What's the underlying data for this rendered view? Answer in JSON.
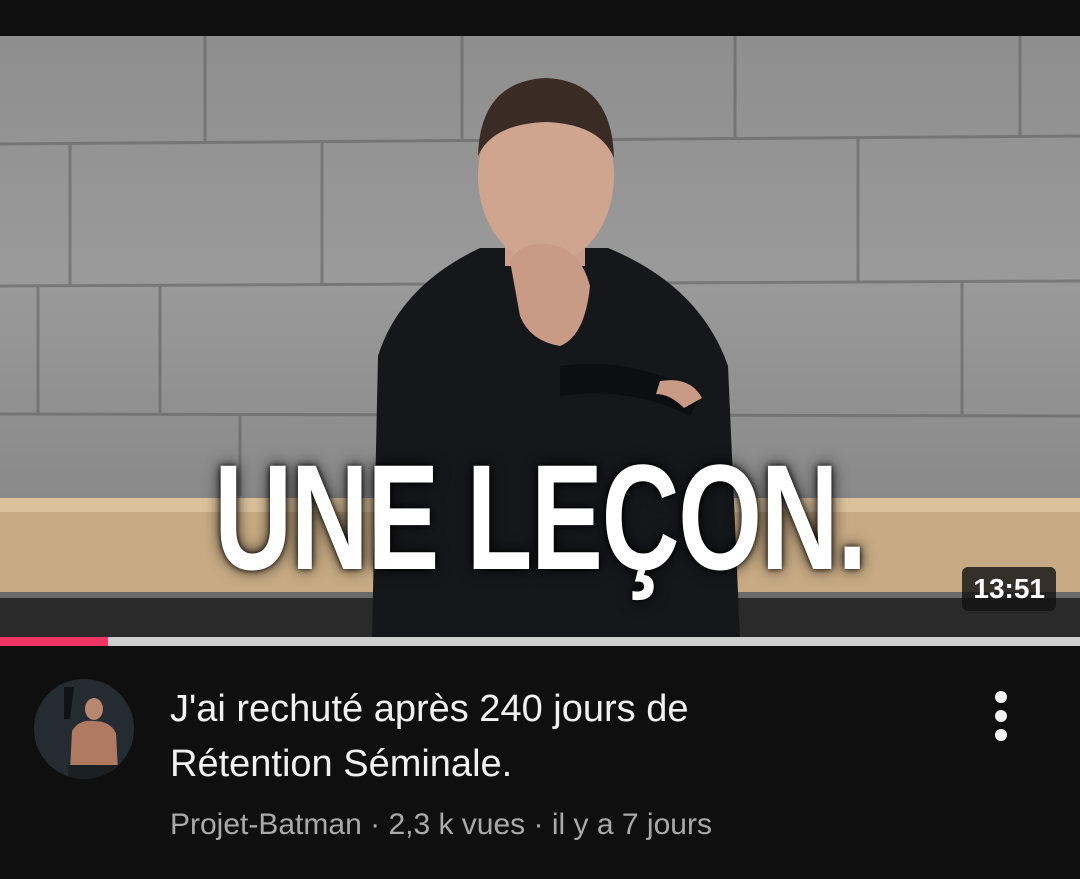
{
  "video": {
    "overlay_text": "UNE LEÇON.",
    "duration": "13:51",
    "watch_progress": 0.1,
    "progress_color": "#f03463",
    "title_line1": "J'ai rechuté après 240 jours de",
    "title_line2": "Rétention Séminale.",
    "channel": "Projet-Batman",
    "separator": "·",
    "views": "2,3 k vues",
    "age": "il y a 7 jours",
    "more_icon": "more-vert-icon"
  }
}
